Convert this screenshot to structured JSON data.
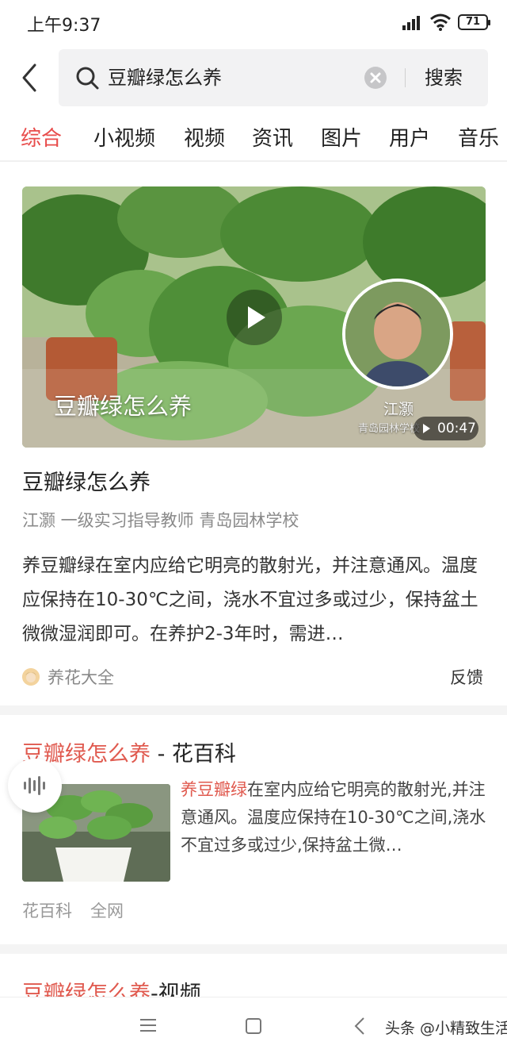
{
  "status_bar": {
    "time": "上午9:37",
    "battery": "71"
  },
  "search": {
    "query": "豆瓣绿怎么养",
    "submit_label": "搜索"
  },
  "tabs": [
    {
      "label": "综合",
      "active": true
    },
    {
      "label": "小视频"
    },
    {
      "label": "视频"
    },
    {
      "label": "资讯"
    },
    {
      "label": "图片"
    },
    {
      "label": "用户"
    },
    {
      "label": "音乐"
    }
  ],
  "card_video": {
    "overlay_title": "豆瓣绿怎么养",
    "presenter_name": "江灏",
    "presenter_org": "青岛园林学校",
    "duration": "00:47",
    "title": "豆瓣绿怎么养",
    "author_line": "江灏 一级实习指导教师 青岛园林学校",
    "summary": "养豆瓣绿在室内应给它明亮的散射光，并注意通风。温度应保持在10-30℃之间，浇水不宜过多或过少，保持盆土微微湿润即可。在养护2-3年时，需进…",
    "source": "养花大全",
    "feedback_label": "反馈"
  },
  "card_article": {
    "title_highlight": "豆瓣绿怎么养",
    "title_rest": " - 花百科",
    "summary_highlight": "养豆瓣绿",
    "summary_rest": "在室内应给它明亮的散射光,并注意通风。温度应保持在10-30℃之间,浇水不宜过多或过少,保持盆土微…",
    "source": "花百科",
    "network": "全网"
  },
  "card_partial": {
    "title_highlight": "豆瓣绿怎么养",
    "title_rest": "-视频"
  },
  "watermark": "头条 @小精致生活",
  "colors": {
    "accent": "#e84b4a",
    "highlight": "#e05a4f"
  }
}
